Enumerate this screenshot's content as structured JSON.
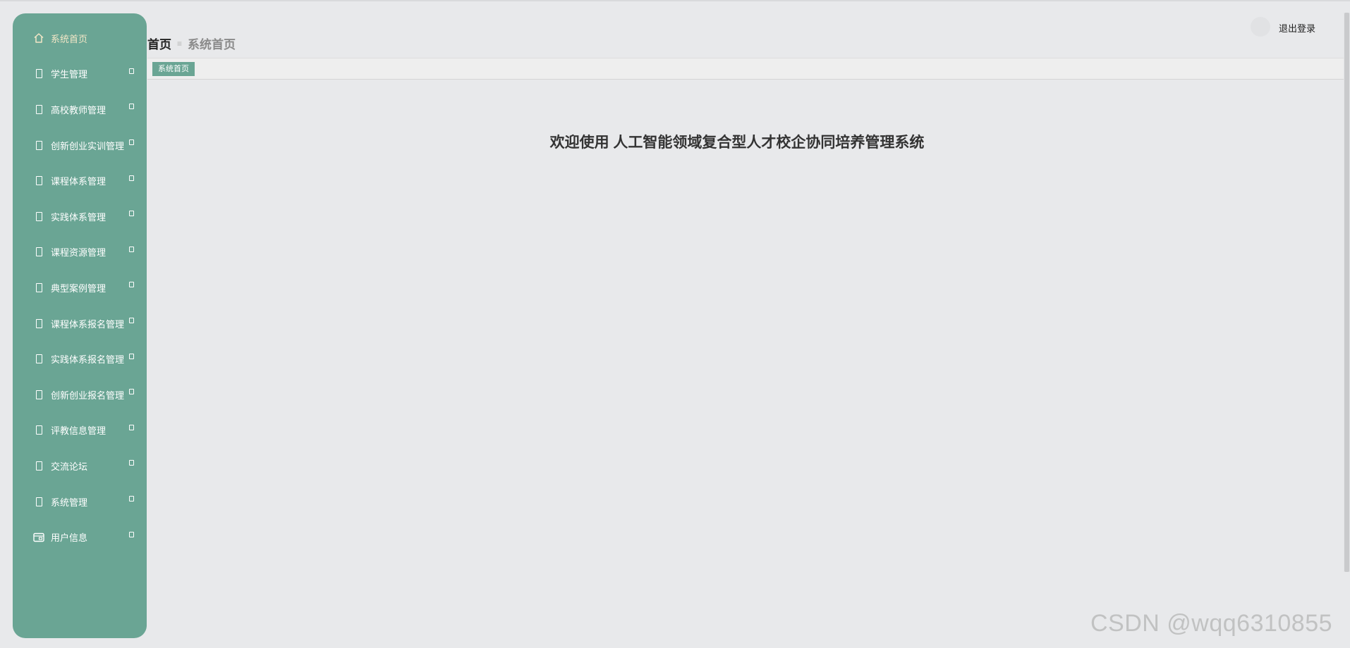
{
  "sidebar": {
    "items": [
      {
        "label": "系统首页",
        "icon": "home-icon",
        "active": true,
        "has_arrow": false
      },
      {
        "label": "学生管理",
        "icon": "box-icon",
        "has_arrow": true
      },
      {
        "label": "高校教师管理",
        "icon": "box-icon",
        "has_arrow": true
      },
      {
        "label": "创新创业实训管理",
        "icon": "box-icon",
        "has_arrow": true
      },
      {
        "label": "课程体系管理",
        "icon": "box-icon",
        "has_arrow": true
      },
      {
        "label": "实践体系管理",
        "icon": "box-icon",
        "has_arrow": true
      },
      {
        "label": "课程资源管理",
        "icon": "box-icon",
        "has_arrow": true
      },
      {
        "label": "典型案例管理",
        "icon": "box-icon",
        "has_arrow": true
      },
      {
        "label": "课程体系报名管理",
        "icon": "box-icon",
        "has_arrow": true
      },
      {
        "label": "实践体系报名管理",
        "icon": "box-icon",
        "has_arrow": true
      },
      {
        "label": "创新创业报名管理",
        "icon": "box-icon",
        "has_arrow": true
      },
      {
        "label": "评教信息管理",
        "icon": "box-icon",
        "has_arrow": true
      },
      {
        "label": "交流论坛",
        "icon": "box-icon",
        "has_arrow": true
      },
      {
        "label": "系统管理",
        "icon": "box-icon",
        "has_arrow": true
      },
      {
        "label": "用户信息",
        "icon": "id-card-icon",
        "has_arrow": true
      }
    ]
  },
  "breadcrumb": {
    "home": "首页",
    "separator": "≡",
    "current": "系统首页"
  },
  "header": {
    "logout_label": "退出登录"
  },
  "tabs": [
    {
      "label": "系统首页",
      "active": true
    }
  ],
  "main": {
    "welcome": "欢迎使用 人工智能领域复合型人才校企协同培养管理系统"
  },
  "watermark": "CSDN @wqq6310855",
  "colors": {
    "sidebar_bg": "#6aa594",
    "accent": "#6aa594",
    "page_bg": "#e8e9eb"
  }
}
